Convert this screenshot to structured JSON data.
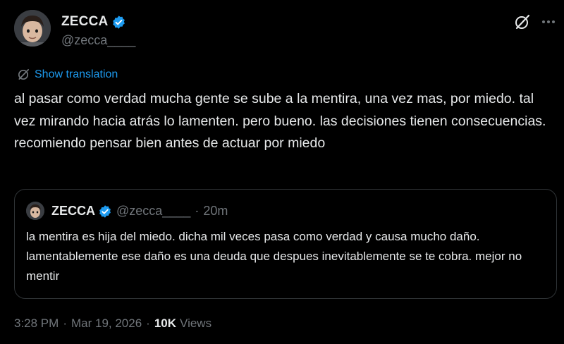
{
  "author": {
    "display_name": "ZECCA",
    "handle": "@zecca____",
    "verified": true
  },
  "translate": {
    "label": "Show translation"
  },
  "tweet": {
    "text": "al pasar como verdad mucha gente se sube a la mentira, una vez mas, por miedo. tal vez mirando hacia atrás lo lamenten. pero bueno. las decisiones tienen consecuencias. recomiendo pensar bien antes de actuar por miedo"
  },
  "quote": {
    "display_name": "ZECCA",
    "handle": "@zecca____",
    "separator": "·",
    "time": "20m",
    "text": "la mentira es hija del miedo. dicha mil veces pasa como verdad y causa mucho daño. lamentablemente ese daño es una deuda que despues inevitablemente se te cobra. mejor no mentir"
  },
  "meta": {
    "time": "3:28 PM",
    "separator": "·",
    "date": "Mar 19, 2026",
    "views_count": "10K",
    "views_label": "Views"
  },
  "icons": {
    "verified": "verified-badge-icon",
    "grok": "grok-icon",
    "more": "more-options-icon",
    "translate": "translate-icon"
  },
  "colors": {
    "background": "#000000",
    "text": "#e7e9ea",
    "secondary": "#71767b",
    "accent": "#1d9bf0",
    "border": "#2f3336"
  }
}
